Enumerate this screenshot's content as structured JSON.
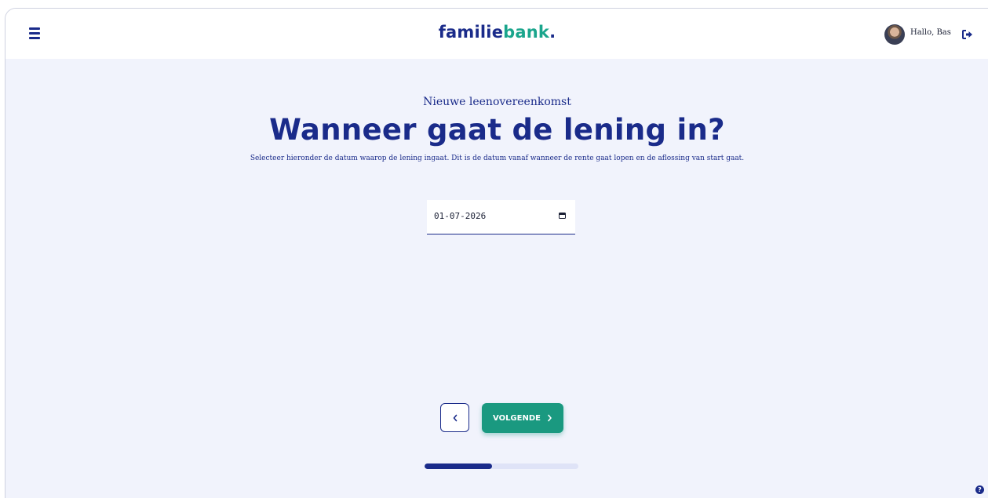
{
  "header": {
    "logo_part1": "familie",
    "logo_part2": "bank",
    "logo_dot": ".",
    "greeting": "Hallo, Bas"
  },
  "main": {
    "subtitle": "Nieuwe leenovereenkomst",
    "title": "Wanneer gaat de lening in?",
    "description": "Selecteer hieronder de datum waarop de lening ingaat. Dit is de datum vanaf wanneer de rente gaat lopen en de aflossing van start gaat.",
    "date_value": "01-07-2026"
  },
  "nav": {
    "next_label": "VOLGENDE"
  },
  "progress": {
    "fraction": 0.44
  },
  "help": {
    "glyph": "?"
  },
  "icons": {
    "menu": "hamburger-menu-icon",
    "logout": "logout-icon",
    "calendar": "calendar-icon",
    "back": "chevron-left-icon",
    "next": "chevron-right-icon",
    "help": "help-icon"
  },
  "colors": {
    "primary": "#1a2b8a",
    "accent": "#1a9980",
    "background": "#f1f3fc"
  }
}
